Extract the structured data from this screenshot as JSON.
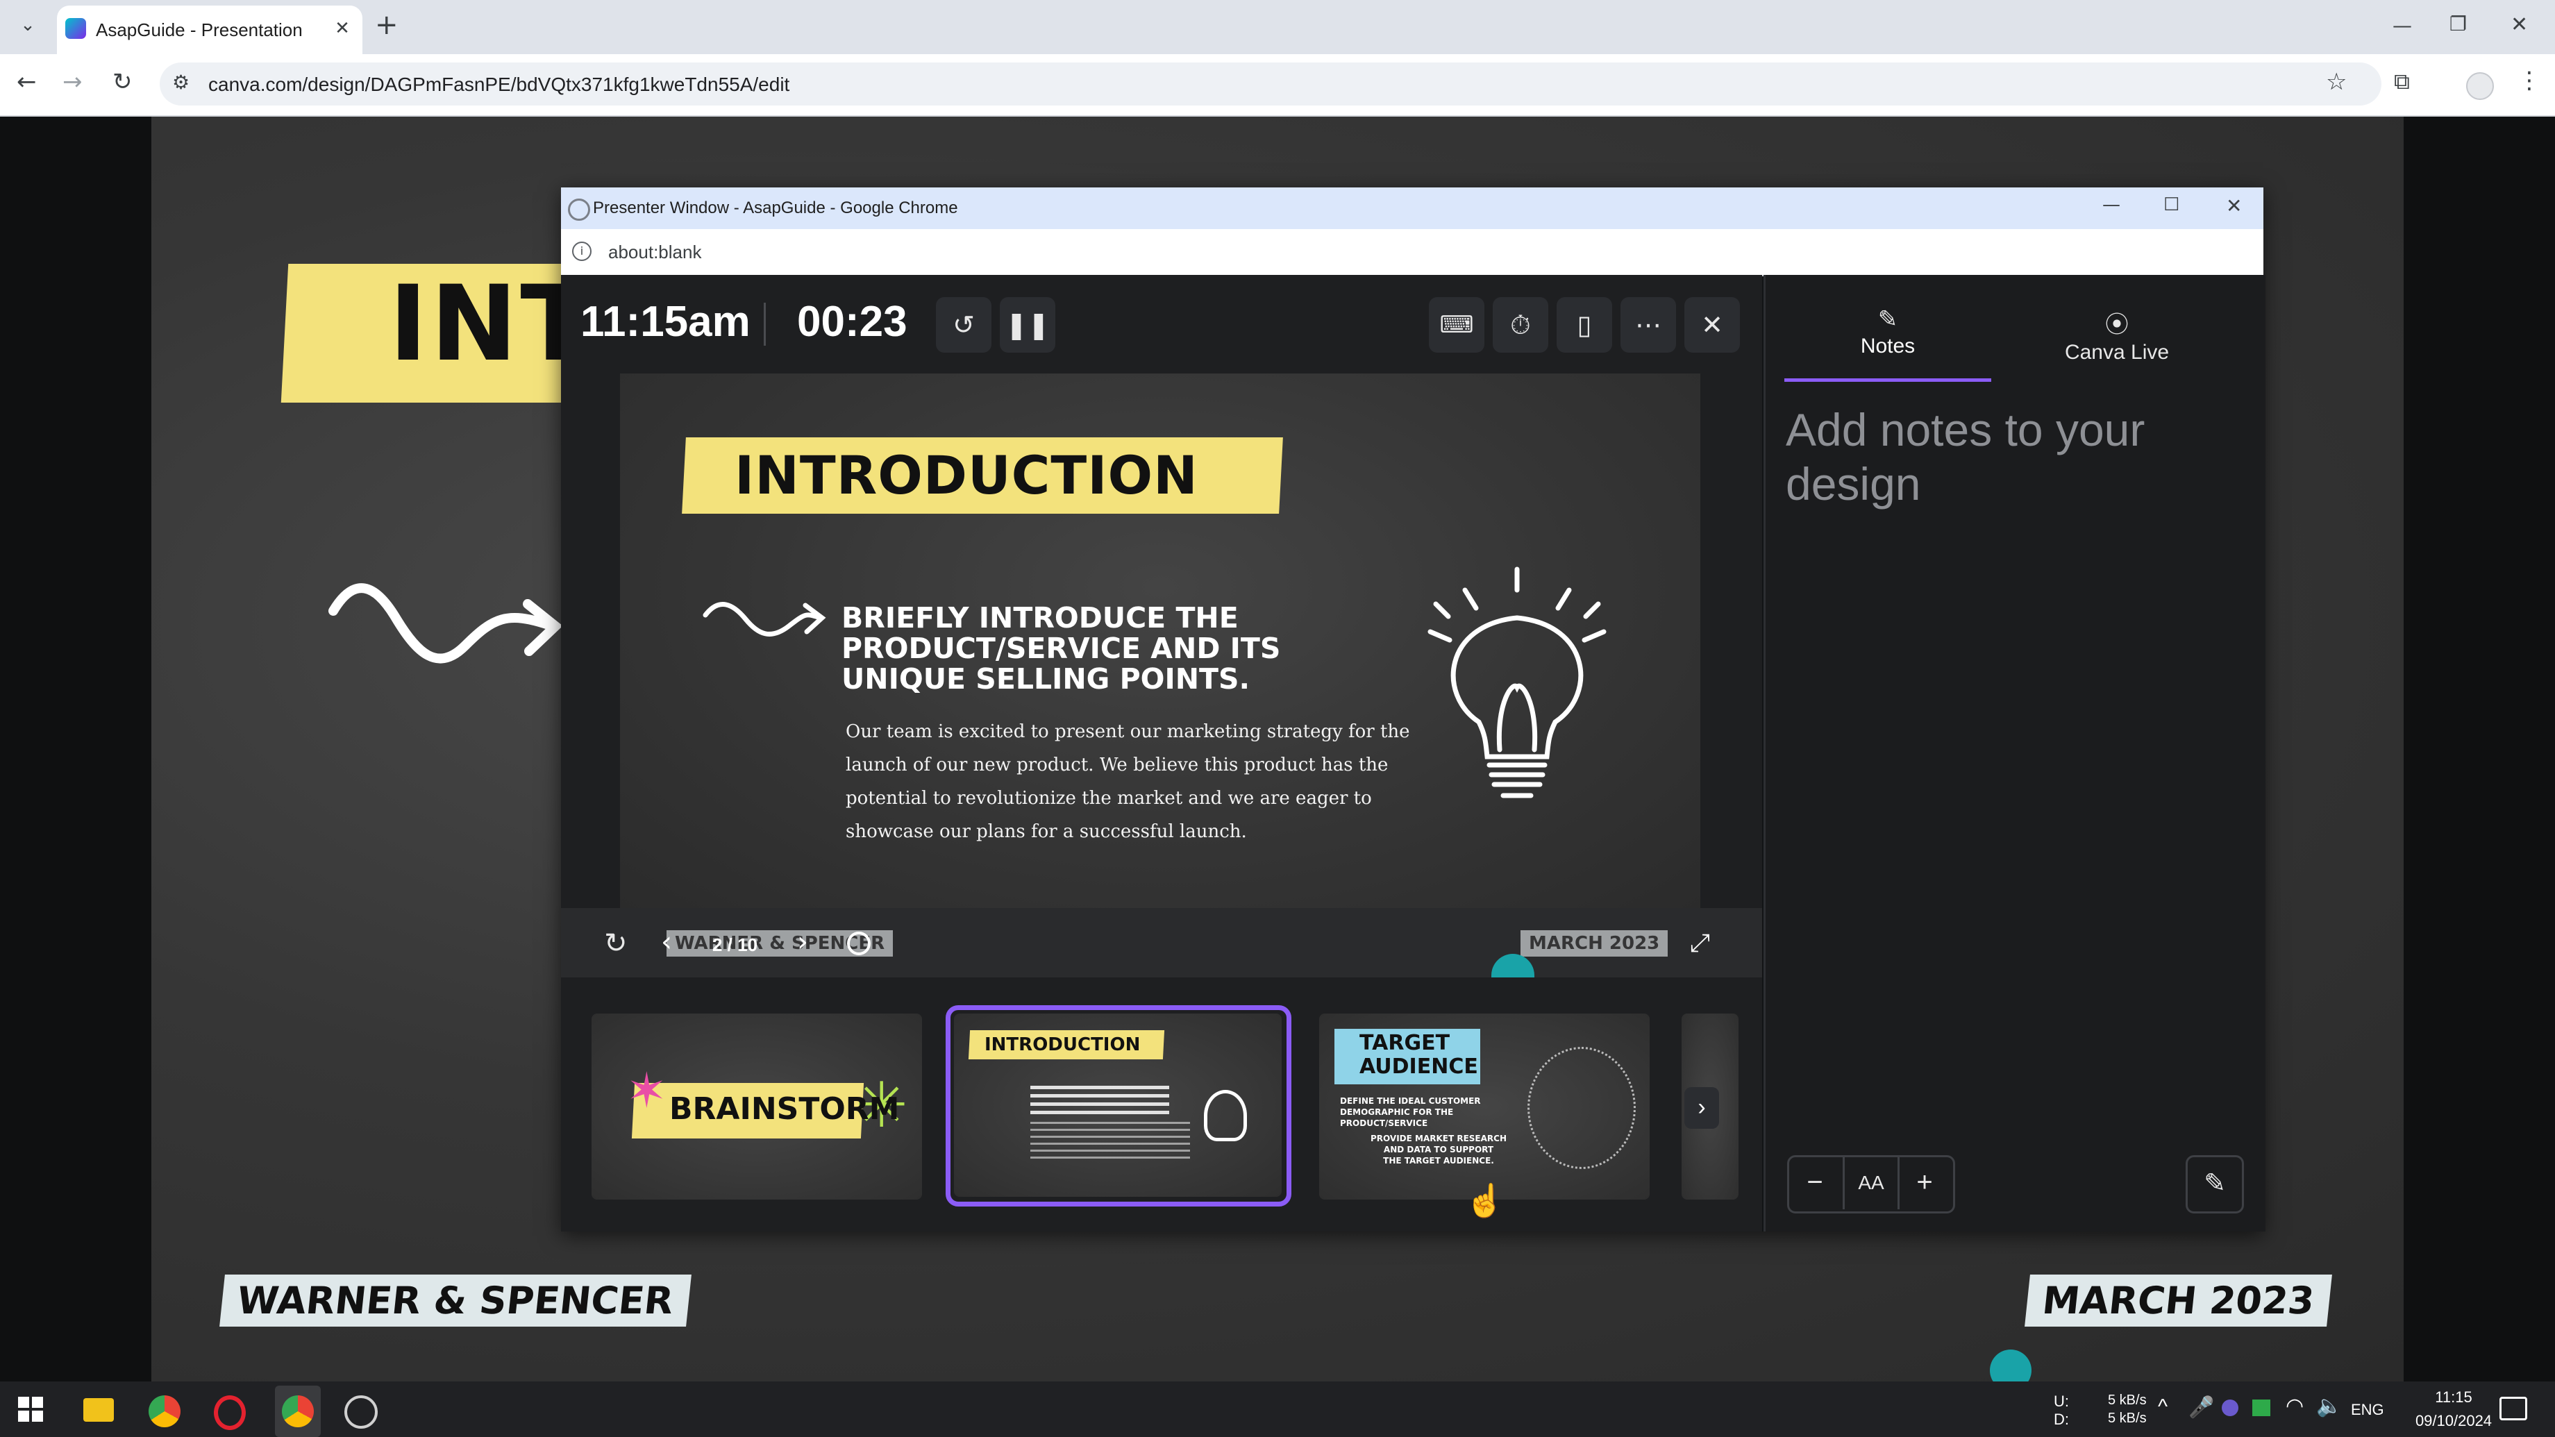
{
  "browser": {
    "tab_title": "AsapGuide - Presentation",
    "url": "canva.com/design/DAGPmFasnPE/bdVQtx371kfg1kweTdn55A/edit",
    "new_tab_symbol": "+",
    "icons": {
      "tab_search": "chevron-down-icon",
      "favicon": "canva-logo-icon",
      "close_tab": "close-icon",
      "back": "arrow-left-icon",
      "forward": "arrow-right-icon",
      "reload": "reload-icon",
      "site_info": "tune-icon",
      "bookmark": "star-icon",
      "extensions": "puzzle-icon",
      "profile": "avatar-icon",
      "menu": "kebab-icon"
    }
  },
  "background_slide": {
    "title_fragment": "INT",
    "footer_left": "WARNER & SPENCER",
    "footer_right": "MARCH 2023"
  },
  "presenter_window": {
    "title": "Presenter Window - AsapGuide - Google Chrome",
    "url": "about:blank",
    "clock": "11:15am",
    "timer": "00:23",
    "toolbar_icons": [
      "restart-timer-icon",
      "pause-icon",
      "keyboard-icon",
      "timer-icon",
      "remote-icon",
      "more-icon",
      "close-icon"
    ],
    "current_slide": {
      "title": "INTRODUCTION",
      "subtitle_lines": [
        "BRIEFLY INTRODUCE THE",
        "PRODUCT/SERVICE AND ITS",
        "UNIQUE SELLING POINTS."
      ],
      "body_lines": [
        "Our team is excited to present our marketing strategy for the",
        "launch of our new product. We believe this product has the",
        "potential to revolutionize the market and we are eager to",
        "showcase our plans for a successful launch."
      ],
      "footer_left": "WARNER & SPENCER",
      "footer_right": "MARCH 2023"
    },
    "slide_counter": "2 / 10",
    "thumbnails": [
      {
        "label": "BRAINSTORM"
      },
      {
        "label": "INTRODUCTION"
      },
      {
        "label": "TARGET AUDIENCE",
        "lines": [
          "DEFINE THE IDEAL CUSTOMER",
          "DEMOGRAPHIC FOR THE",
          "PRODUCT/SERVICE",
          "PROVIDE MARKET RESEARCH",
          "AND DATA TO SUPPORT",
          "THE TARGET AUDIENCE."
        ]
      }
    ],
    "selected_thumbnail": 1,
    "sidebar": {
      "tabs": [
        {
          "label": "Notes",
          "icon": "notes-icon"
        },
        {
          "label": "Canva Live",
          "icon": "broadcast-icon"
        }
      ],
      "notes_placeholder": "Add notes to your design",
      "font_size_label": "AA"
    }
  },
  "taskbar": {
    "net_up_label": "U:",
    "net_down_label": "D:",
    "net_up": "5 kB/s",
    "net_down": "5 kB/s",
    "language": "ENG",
    "time": "11:15",
    "date": "09/10/2024",
    "apps": [
      "windows-start-icon",
      "file-explorer-icon",
      "chrome-icon",
      "opera-icon",
      "chrome-active-icon",
      "clock-app-icon"
    ]
  },
  "colors": {
    "accent_purple": "#8b5cf6",
    "brush_yellow": "#f3e27c",
    "teal_dot": "#19a3a8"
  }
}
